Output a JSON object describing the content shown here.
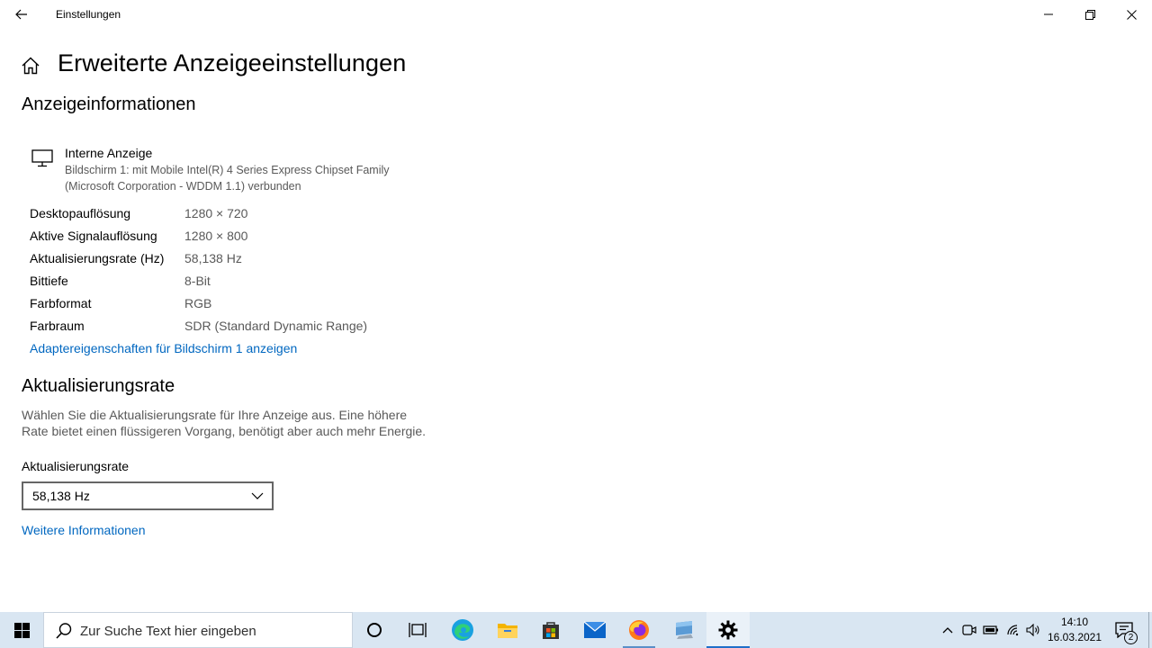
{
  "window": {
    "title": "Einstellungen"
  },
  "page": {
    "title": "Erweiterte Anzeigeeinstellungen"
  },
  "display_info": {
    "heading": "Anzeigeinformationen",
    "display_name": "Interne Anzeige",
    "display_desc_line1": "Bildschirm 1: mit Mobile Intel(R) 4 Series Express Chipset Family",
    "display_desc_line2": "(Microsoft Corporation - WDDM 1.1) verbunden",
    "rows": [
      {
        "label": "Desktopauflösung",
        "value": "1280 × 720"
      },
      {
        "label": "Aktive Signalauflösung",
        "value": "1280 × 800"
      },
      {
        "label": "Aktualisierungsrate (Hz)",
        "value": "58,138 Hz"
      },
      {
        "label": "Bittiefe",
        "value": "8-Bit"
      },
      {
        "label": "Farbformat",
        "value": "RGB"
      },
      {
        "label": "Farbraum",
        "value": "SDR (Standard Dynamic Range)"
      }
    ],
    "adapter_link": "Adaptereigenschaften für Bildschirm 1 anzeigen"
  },
  "refresh": {
    "heading": "Aktualisierungsrate",
    "desc_line1": "Wählen Sie die Aktualisierungsrate für Ihre Anzeige aus. Eine höhere",
    "desc_line2": "Rate bietet einen flüssigeren Vorgang, benötigt aber auch mehr Energie.",
    "field_label": "Aktualisierungsrate",
    "selected": "58,138 Hz",
    "more_link": "Weitere Informationen"
  },
  "taskbar": {
    "search_placeholder": "Zur Suche Text hier eingeben",
    "apps": [
      "cortana",
      "task-view",
      "edge",
      "file-explorer",
      "store",
      "mail",
      "firefox",
      "remote-desktop",
      "settings"
    ],
    "time": "14:10",
    "date": "16.03.2021",
    "notification_count": "2"
  },
  "colors": {
    "accent": "#0067c0",
    "taskbar_bg": "#d9e6f2",
    "secondary_text": "#595959"
  }
}
